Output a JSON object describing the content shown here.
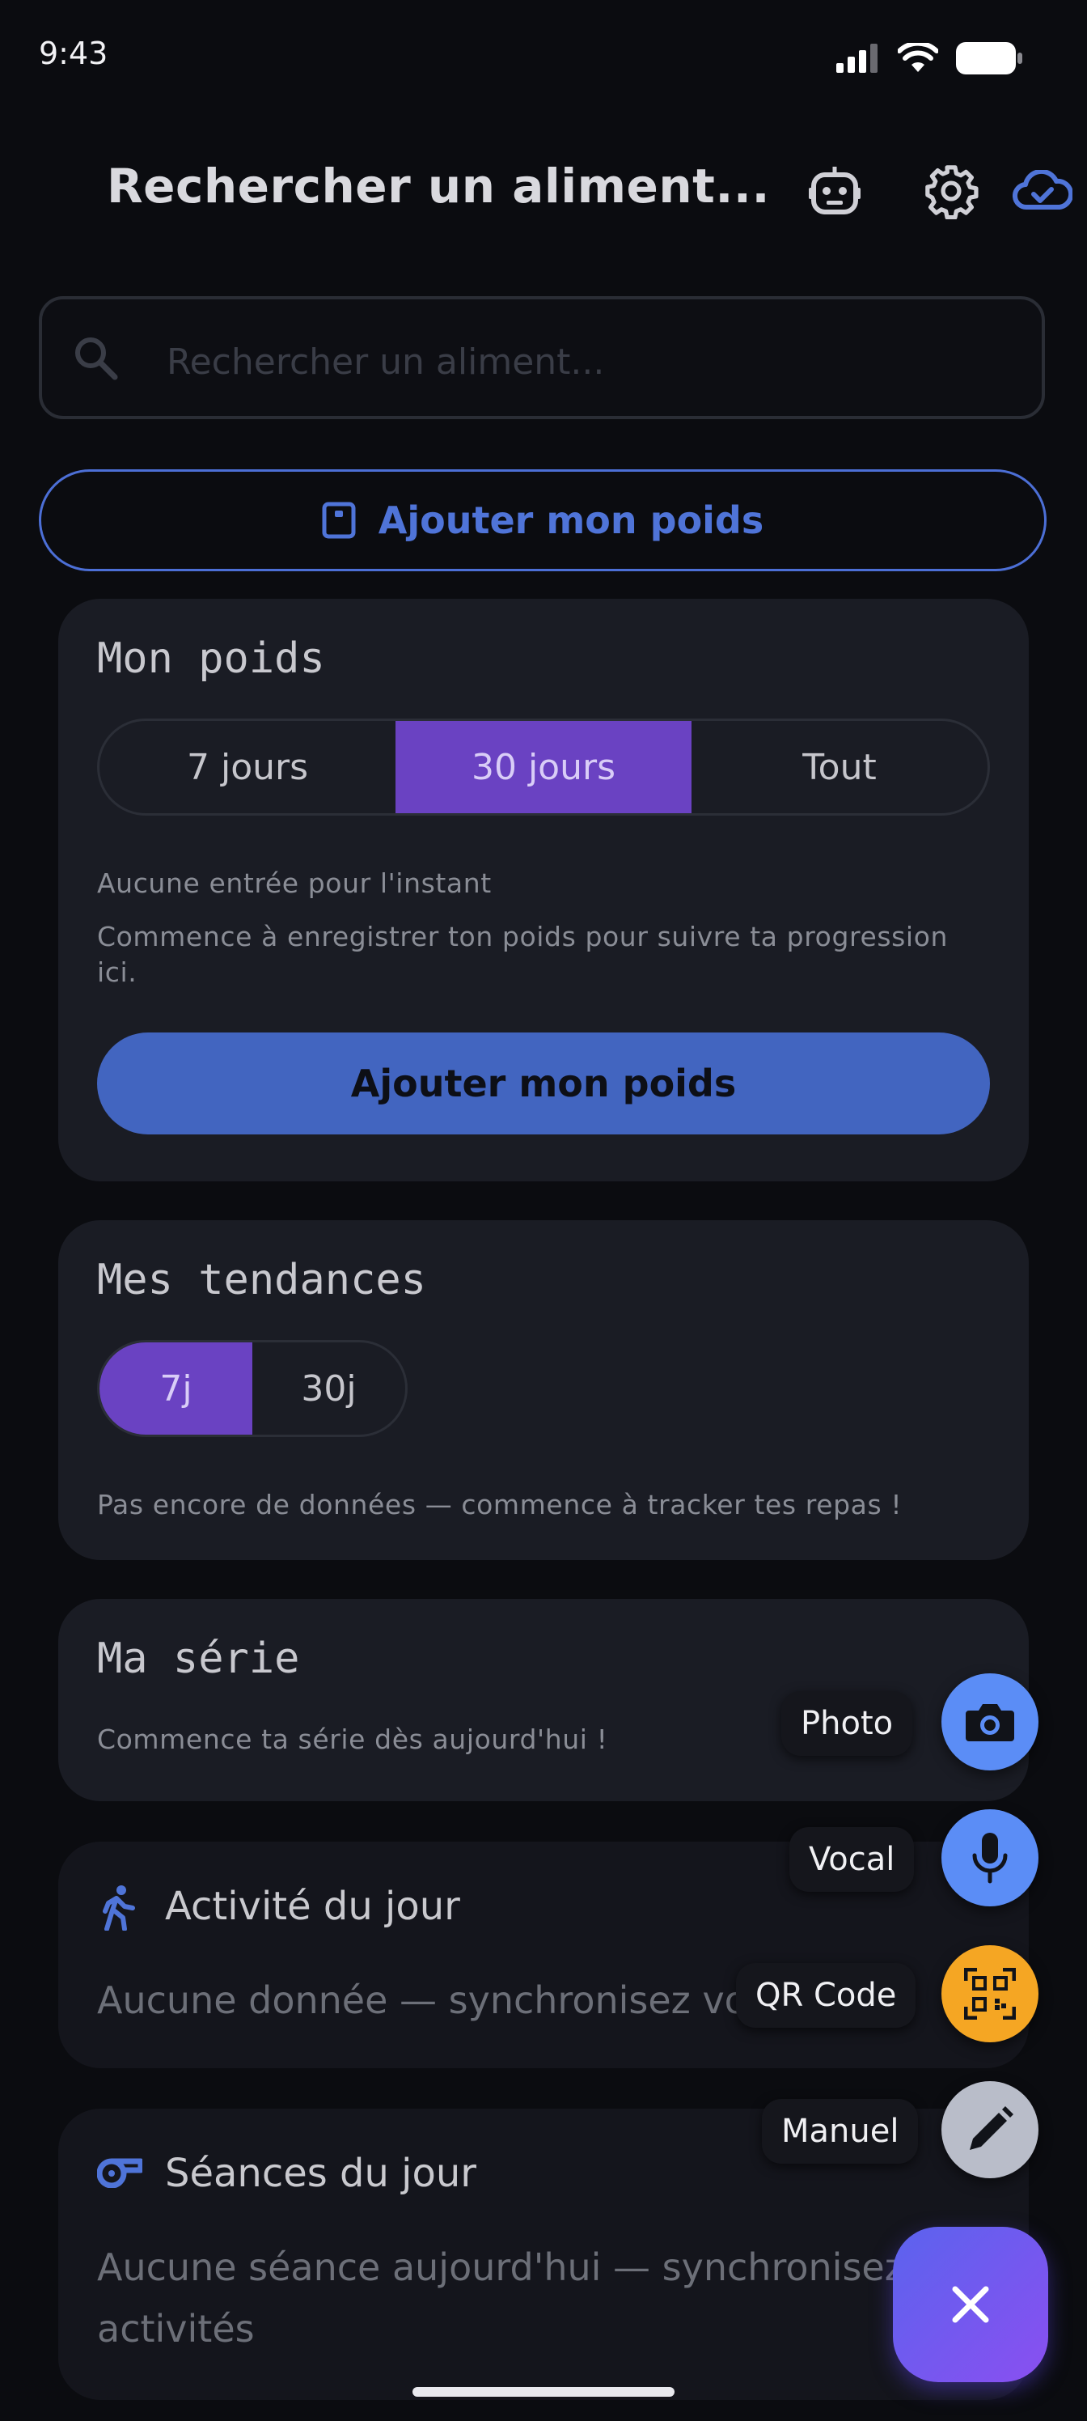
{
  "status": {
    "time": "9:43"
  },
  "header": {
    "title": "Rechercher un aliment..."
  },
  "search": {
    "placeholder": "Rechercher un aliment..."
  },
  "add_weight_outline": {
    "label": "Ajouter mon poids"
  },
  "weight_card": {
    "title": "Mon poids",
    "ranges": [
      {
        "label": "7 jours",
        "active": false
      },
      {
        "label": "30 jours",
        "active": true
      },
      {
        "label": "Tout",
        "active": false
      }
    ],
    "empty_title": "Aucune entrée pour l'instant",
    "empty_text": "Commence à enregistrer ton poids pour suivre ta progression ici.",
    "button": "Ajouter mon poids"
  },
  "trends_card": {
    "title": "Mes tendances",
    "ranges": [
      {
        "label": "7j",
        "active": true
      },
      {
        "label": "30j",
        "active": false
      }
    ],
    "empty_text": "Pas encore de données — commence à tracker tes repas !"
  },
  "streak_card": {
    "title": "Ma série",
    "text": "Commence ta série dès aujourd'hui !"
  },
  "activity_card": {
    "title": "Activité du jour",
    "text": "Aucune donnée — synchronisez vos"
  },
  "sessions_card": {
    "title": "Séances du jour",
    "text_line1": "Aucune séance aujourd'hui — synchronisez v",
    "text_line2": "activités"
  },
  "fab_menu": {
    "items": [
      {
        "label": "Photo",
        "icon": "camera-icon",
        "color": "#5b8df6"
      },
      {
        "label": "Vocal",
        "icon": "microphone-icon",
        "color": "#5b8df6"
      },
      {
        "label": "QR Code",
        "icon": "qr-code-icon",
        "color": "#f5a623"
      },
      {
        "label": "Manuel",
        "icon": "pencil-icon",
        "color": "#b9bdc9"
      }
    ],
    "close_icon": "close-icon"
  },
  "colors": {
    "accent_blue": "#4265c0",
    "accent_purple": "#6a42c2",
    "background": "#0b0c10",
    "card": "#1a1c24"
  }
}
